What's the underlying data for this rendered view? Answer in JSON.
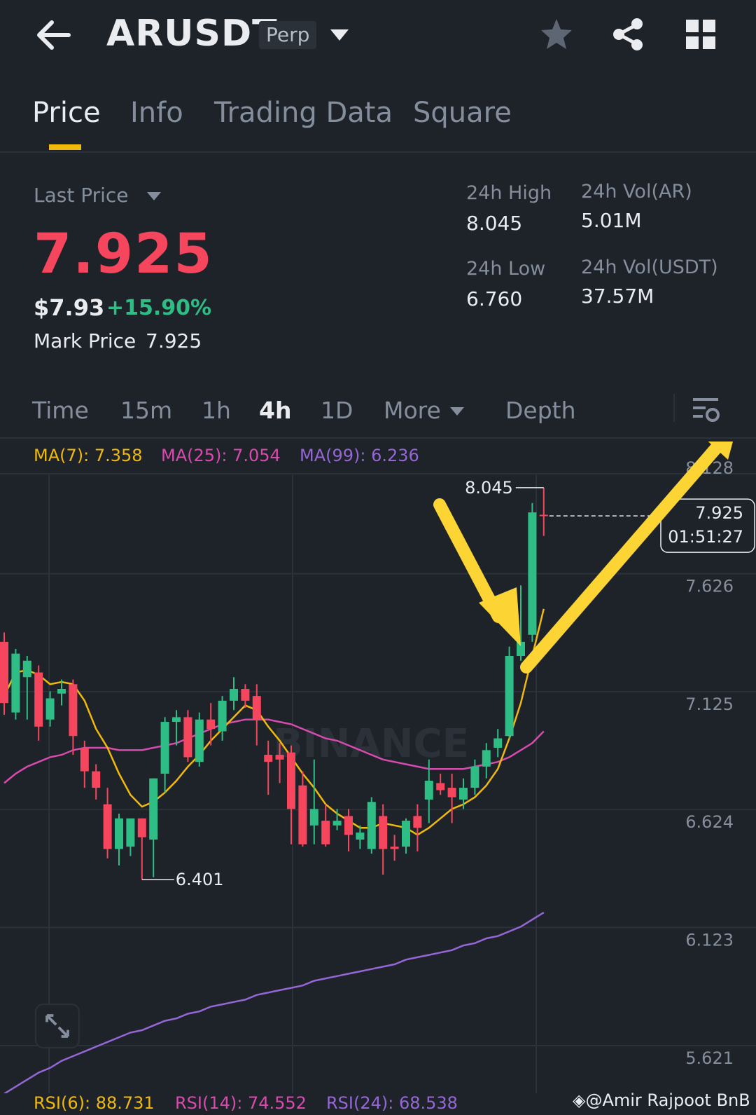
{
  "header": {
    "symbol": "ARUSDT",
    "contract_type": "Perp",
    "icons": [
      "arrow-left-icon",
      "caret-down-icon",
      "star-icon",
      "share-icon",
      "grid-icon"
    ]
  },
  "tabs": [
    {
      "label": "Price",
      "active": true
    },
    {
      "label": "Info",
      "active": false
    },
    {
      "label": "Trading Data",
      "active": false
    },
    {
      "label": "Square",
      "active": false
    }
  ],
  "ticker": {
    "last_price_label": "Last Price",
    "last_price": "7.925",
    "usd_price": "$7.93",
    "change_pct": "+15.90%",
    "mark_price_label": "Mark Price",
    "mark_price": "7.925",
    "high_label": "24h High",
    "high": "8.045",
    "low_label": "24h Low",
    "low": "6.760",
    "vol_ar_label": "24h Vol(AR)",
    "vol_ar": "5.01M",
    "vol_usdt_label": "24h Vol(USDT)",
    "vol_usdt": "37.57M"
  },
  "intervals": {
    "items": [
      "Time",
      "15m",
      "1h",
      "4h",
      "1D",
      "More",
      "Depth"
    ],
    "active": "4h"
  },
  "indicators": {
    "ma7": "MA(7): 7.358",
    "ma25": "MA(25): 7.054",
    "ma99": "MA(99): 6.236",
    "rsi6": "RSI(6): 88.731",
    "rsi14": "RSI(14): 74.552",
    "rsi24": "RSI(24): 68.538"
  },
  "colors": {
    "up": "#2ebd85",
    "down": "#f6465d",
    "ma7": "#f0b90b",
    "ma25": "#d84bae",
    "ma99": "#9567d6",
    "accent": "#f0b90b",
    "arrow": "#fcd535"
  },
  "chart": {
    "price_axis": [
      "8.128",
      "7.626",
      "7.125",
      "6.624",
      "6.123",
      "5.621"
    ],
    "current_price_tag": "7.925",
    "countdown": "01:51:27",
    "high_marker": "8.045",
    "low_marker": "6.401",
    "logo_text": "BINANCE"
  },
  "chart_data": {
    "type": "candlestick",
    "interval": "4h",
    "ylim": [
      5.45,
      8.3
    ],
    "candles": [
      {
        "o": 7.39,
        "h": 7.43,
        "l": 7.08,
        "c": 7.13
      },
      {
        "o": 7.09,
        "h": 7.36,
        "l": 7.06,
        "c": 7.34
      },
      {
        "o": 7.24,
        "h": 7.33,
        "l": 7.06,
        "c": 7.31
      },
      {
        "o": 7.26,
        "h": 7.29,
        "l": 6.97,
        "c": 7.03
      },
      {
        "o": 7.06,
        "h": 7.18,
        "l": 7.03,
        "c": 7.15
      },
      {
        "o": 7.17,
        "h": 7.23,
        "l": 7.12,
        "c": 7.19
      },
      {
        "o": 7.21,
        "h": 7.23,
        "l": 6.91,
        "c": 6.99
      },
      {
        "o": 6.94,
        "h": 6.97,
        "l": 6.77,
        "c": 6.84
      },
      {
        "o": 6.84,
        "h": 6.87,
        "l": 6.72,
        "c": 6.77
      },
      {
        "o": 6.7,
        "h": 6.77,
        "l": 6.47,
        "c": 6.51
      },
      {
        "o": 6.51,
        "h": 6.66,
        "l": 6.44,
        "c": 6.64
      },
      {
        "o": 6.52,
        "h": 6.63,
        "l": 6.48,
        "c": 6.64
      },
      {
        "o": 6.64,
        "h": 6.64,
        "l": 6.38,
        "c": 6.56
      },
      {
        "o": 6.55,
        "h": 6.81,
        "l": 6.39,
        "c": 6.81
      },
      {
        "o": 6.83,
        "h": 7.07,
        "l": 6.75,
        "c": 7.05
      },
      {
        "o": 7.05,
        "h": 7.1,
        "l": 6.95,
        "c": 7.07
      },
      {
        "o": 7.07,
        "h": 7.1,
        "l": 6.88,
        "c": 6.9
      },
      {
        "o": 6.88,
        "h": 7.09,
        "l": 6.86,
        "c": 7.06
      },
      {
        "o": 7.06,
        "h": 7.13,
        "l": 6.95,
        "c": 7.02
      },
      {
        "o": 7.01,
        "h": 7.16,
        "l": 6.97,
        "c": 7.14
      },
      {
        "o": 7.14,
        "h": 7.24,
        "l": 7.1,
        "c": 7.19
      },
      {
        "o": 7.19,
        "h": 7.21,
        "l": 7.11,
        "c": 7.14
      },
      {
        "o": 7.16,
        "h": 7.21,
        "l": 6.95,
        "c": 7.06
      },
      {
        "o": 6.91,
        "h": 6.97,
        "l": 6.74,
        "c": 6.88
      },
      {
        "o": 6.91,
        "h": 6.96,
        "l": 6.79,
        "c": 6.89
      },
      {
        "o": 6.92,
        "h": 6.95,
        "l": 6.53,
        "c": 6.68
      },
      {
        "o": 6.78,
        "h": 6.84,
        "l": 6.52,
        "c": 6.53
      },
      {
        "o": 6.61,
        "h": 6.89,
        "l": 6.53,
        "c": 6.68
      },
      {
        "o": 6.63,
        "h": 6.7,
        "l": 6.52,
        "c": 6.53
      },
      {
        "o": 6.61,
        "h": 6.68,
        "l": 6.59,
        "c": 6.63
      },
      {
        "o": 6.65,
        "h": 6.68,
        "l": 6.5,
        "c": 6.57
      },
      {
        "o": 6.55,
        "h": 6.61,
        "l": 6.51,
        "c": 6.58
      },
      {
        "o": 6.51,
        "h": 6.73,
        "l": 6.49,
        "c": 6.71
      },
      {
        "o": 6.65,
        "h": 6.7,
        "l": 6.401,
        "c": 6.51
      },
      {
        "o": 6.52,
        "h": 6.57,
        "l": 6.46,
        "c": 6.51
      },
      {
        "o": 6.52,
        "h": 6.64,
        "l": 6.49,
        "c": 6.63
      },
      {
        "o": 6.65,
        "h": 6.7,
        "l": 6.5,
        "c": 6.6
      },
      {
        "o": 6.72,
        "h": 6.89,
        "l": 6.62,
        "c": 6.8
      },
      {
        "o": 6.79,
        "h": 6.83,
        "l": 6.74,
        "c": 6.76
      },
      {
        "o": 6.77,
        "h": 6.83,
        "l": 6.62,
        "c": 6.73
      },
      {
        "o": 6.72,
        "h": 6.81,
        "l": 6.68,
        "c": 6.77
      },
      {
        "o": 6.77,
        "h": 6.89,
        "l": 6.74,
        "c": 6.86
      },
      {
        "o": 6.86,
        "h": 6.96,
        "l": 6.81,
        "c": 6.93
      },
      {
        "o": 6.94,
        "h": 7.02,
        "l": 6.9,
        "c": 6.98
      },
      {
        "o": 6.99,
        "h": 7.37,
        "l": 6.98,
        "c": 7.33
      },
      {
        "o": 7.33,
        "h": 7.63,
        "l": 7.31,
        "c": 7.39
      },
      {
        "o": 7.42,
        "h": 7.98,
        "l": 7.39,
        "c": 7.94
      },
      {
        "o": 7.93,
        "h": 8.045,
        "l": 7.84,
        "c": 7.925
      }
    ],
    "ma7": [
      7.16,
      7.26,
      7.27,
      7.25,
      7.21,
      7.22,
      7.21,
      7.14,
      7.02,
      6.94,
      6.83,
      6.74,
      6.69,
      6.71,
      6.75,
      6.8,
      6.86,
      6.91,
      6.97,
      7.02,
      7.07,
      7.12,
      7.1,
      7.03,
      6.97,
      6.9,
      6.83,
      6.77,
      6.7,
      6.66,
      6.63,
      6.6,
      6.6,
      6.62,
      6.61,
      6.6,
      6.57,
      6.6,
      6.64,
      6.68,
      6.7,
      6.73,
      6.78,
      6.85,
      6.98,
      7.13,
      7.33,
      7.53
    ],
    "ma25": [
      6.79,
      6.83,
      6.86,
      6.88,
      6.9,
      6.91,
      6.93,
      6.94,
      6.94,
      6.94,
      6.93,
      6.93,
      6.93,
      6.94,
      6.95,
      6.96,
      6.98,
      7.0,
      7.02,
      7.04,
      7.05,
      7.06,
      7.06,
      7.06,
      7.05,
      7.04,
      7.02,
      7.0,
      6.98,
      6.97,
      6.95,
      6.93,
      6.91,
      6.89,
      6.88,
      6.87,
      6.86,
      6.85,
      6.85,
      6.85,
      6.85,
      6.86,
      6.87,
      6.88,
      6.9,
      6.93,
      6.96,
      7.01
    ],
    "ma99": [
      5.47,
      5.5,
      5.53,
      5.56,
      5.58,
      5.61,
      5.63,
      5.65,
      5.67,
      5.69,
      5.71,
      5.73,
      5.74,
      5.76,
      5.78,
      5.79,
      5.81,
      5.82,
      5.84,
      5.85,
      5.86,
      5.87,
      5.89,
      5.9,
      5.91,
      5.92,
      5.93,
      5.95,
      5.96,
      5.97,
      5.98,
      5.99,
      6.0,
      6.01,
      6.02,
      6.04,
      6.05,
      6.06,
      6.07,
      6.08,
      6.1,
      6.11,
      6.13,
      6.14,
      6.16,
      6.18,
      6.21,
      6.24
    ]
  },
  "watermark": "@Amir Rajpoot BnB"
}
